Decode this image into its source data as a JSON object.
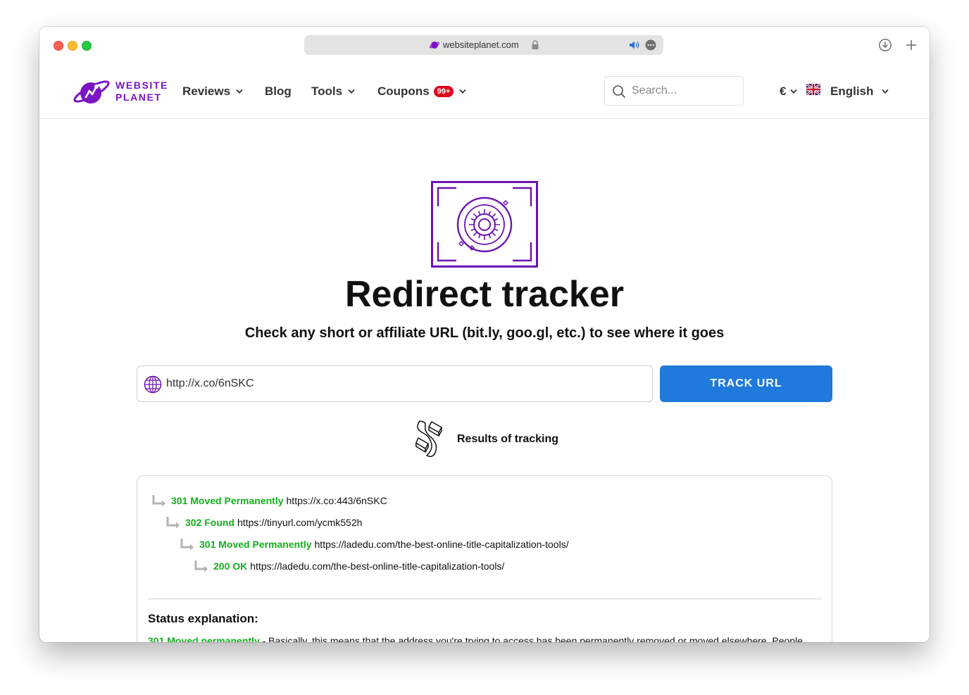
{
  "browser": {
    "address": "websiteplanet.com"
  },
  "site": {
    "logo_line1": "WEBSITE",
    "logo_line2": "PLANET",
    "nav": {
      "reviews": "Reviews",
      "blog": "Blog",
      "tools": "Tools",
      "coupons": "Coupons",
      "coupons_badge": "99+"
    },
    "search_placeholder": "Search...",
    "currency": "€",
    "language": "English"
  },
  "hero": {
    "title": "Redirect tracker",
    "subtitle": "Check any short or affiliate URL (bit.ly, goo.gl, etc.) to see where it goes"
  },
  "tracker": {
    "input_value": "http://x.co/6nSKC",
    "button_label": "TRACK URL",
    "results_label": "Results of tracking"
  },
  "redirects": [
    {
      "status": "301 Moved Permanently",
      "url": "https://x.co:443/6nSKC"
    },
    {
      "status": "302 Found",
      "url": "https://tinyurl.com/ycmk552h"
    },
    {
      "status": "301 Moved Permanently",
      "url": "https://ladedu.com/the-best-online-title-capitalization-tools/"
    },
    {
      "status": "200 OK",
      "url": "https://ladedu.com/the-best-online-title-capitalization-tools/"
    }
  ],
  "explanation": {
    "heading": "Status explanation:",
    "first_status": "301 Moved permanently",
    "first_text": " - Basically, this means that the address you're trying to access has been permanently removed or moved elsewhere. People"
  },
  "colors": {
    "brand": "#7a14c4",
    "button": "#1f7adb",
    "status_ok": "#13b01c",
    "badge": "#e0001b"
  }
}
